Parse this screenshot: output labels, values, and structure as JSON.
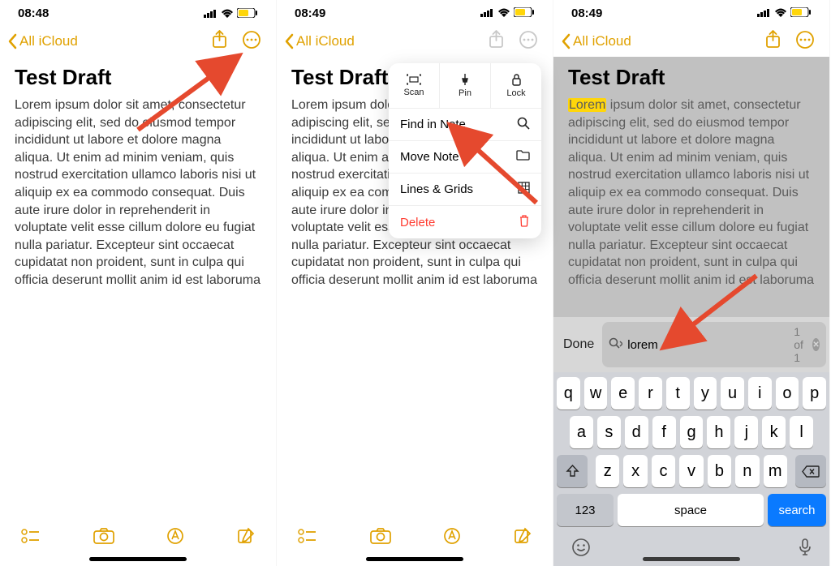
{
  "status": {
    "time1": "08:48",
    "time2": "08:49",
    "time3": "08:49"
  },
  "nav": {
    "back": "All iCloud"
  },
  "note": {
    "title": "Test Draft",
    "body": "Lorem ipsum dolor sit amet, consectetur adipiscing elit, sed do eiusmod tempor incididunt ut labore et dolore magna aliqua. Ut enim ad minim veniam, quis nostrud exercitation ullamco laboris nisi ut aliquip ex ea commodo consequat. Duis aute irure dolor in reprehenderit in voluptate velit esse cillum dolore eu fugiat nulla pariatur. Excepteur sint occaecat cupidatat non proident, sunt in culpa qui officia deserunt mollit anim id est laboruma",
    "body_short": "Lorem ipsum dolor sit amet, consectetur adipiscing elit, sed do eiusmod tempor incididunt ut labore et dolore magna aliqua. Ut enim ad minim veniam, quis nostrud exercitation ullamco laboris nisi ut aliquip ex ea commodo consequat. Duis aute irure dolor in reprehenderit in voluptate velit esse cillum dolore eu fugiat nulla pariatur. Excepteur sint occaecat cupidatat non proident, sunt in culpa qui officia deserunt mollit anim id est laboruma",
    "highlight_word": "Lorem",
    "body_after_highlight": " ipsum dolor sit amet, consectetur adipiscing elit, sed do eiusmod tempor incididunt ut labore et dolore magna aliqua. Ut enim ad minim veniam, quis nostrud exercitation ullamco laboris nisi ut aliquip ex ea commodo consequat. Duis aute irure dolor in reprehenderit in voluptate velit esse cillum dolore eu fugiat nulla pariatur. Excepteur sint occaecat cupidatat non proident, sunt in culpa qui officia deserunt mollit anim id est laboruma"
  },
  "popup": {
    "scan": "Scan",
    "pin": "Pin",
    "lock": "Lock",
    "find": "Find in Note",
    "move": "Move Note",
    "lines": "Lines & Grids",
    "delete": "Delete"
  },
  "search": {
    "done": "Done",
    "query": "lorem",
    "count": "1 of 1"
  },
  "keyboard": {
    "row1": [
      "q",
      "w",
      "e",
      "r",
      "t",
      "y",
      "u",
      "i",
      "o",
      "p"
    ],
    "row2": [
      "a",
      "s",
      "d",
      "f",
      "g",
      "h",
      "j",
      "k",
      "l"
    ],
    "row3": [
      "z",
      "x",
      "c",
      "v",
      "b",
      "n",
      "m"
    ],
    "num": "123",
    "space": "space",
    "search": "search"
  }
}
